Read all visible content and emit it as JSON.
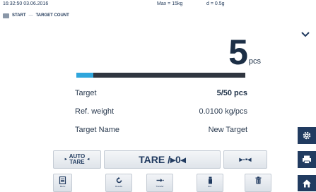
{
  "status": {
    "datetime": "16:32:50 03.06.2016",
    "max": "Max = 15kg",
    "d": "d = 0.5g"
  },
  "breadcrumb": {
    "start": "START",
    "separator": "—",
    "current": "TARGET COUNT"
  },
  "readout": {
    "value": "5",
    "unit": "pcs"
  },
  "progress": {
    "fraction": 0.1,
    "fill_color": "#2fa6dc"
  },
  "info": [
    {
      "label": "Target",
      "value": "5/50 pcs"
    },
    {
      "label": "Ref. weight",
      "value": "0.0100 kg/pcs"
    },
    {
      "label": "Target Name",
      "value": "New Target"
    }
  ],
  "buttons": {
    "auto_tare_line1": "AUTO",
    "auto_tare_line2": "TARE",
    "tare_zero": "TARE /▸0◂",
    "tool_label": "▸-▪◂"
  },
  "function_keys": [
    {
      "icon": "menu-icon",
      "label": "Menu"
    },
    {
      "icon": "refresh-icon",
      "label": "Results"
    },
    {
      "icon": "transfer-icon",
      "label": "Transfer"
    },
    {
      "icon": "weight-icon",
      "label": "Ref."
    },
    {
      "icon": "trash-icon",
      "label": ""
    }
  ],
  "sidebar": [
    "gear-icon",
    "printer-icon",
    "home-icon"
  ],
  "colors": {
    "accent": "#2fa6dc",
    "navy": "#213b60"
  }
}
